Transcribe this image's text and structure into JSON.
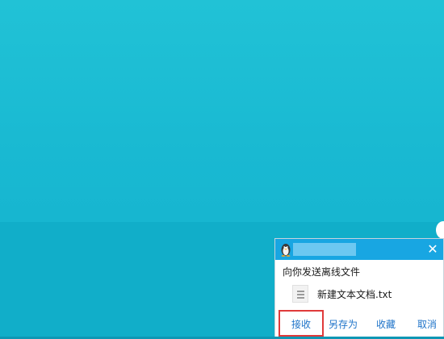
{
  "notification": {
    "message": "向你发送离线文件",
    "file_name": "新建文本文档.txt",
    "close_glyph": "✕",
    "actions": {
      "receive": "接收",
      "save_as": "另存为",
      "favorite": "收藏",
      "cancel": "取消"
    },
    "icons": {
      "app": "qq-penguin-icon",
      "file": "text-file-icon",
      "close": "close-icon"
    }
  },
  "colors": {
    "desktop": "#19b9d2",
    "titlebar": "#18a6e2",
    "link": "#1f74c9",
    "highlight": "#e03a3a"
  }
}
